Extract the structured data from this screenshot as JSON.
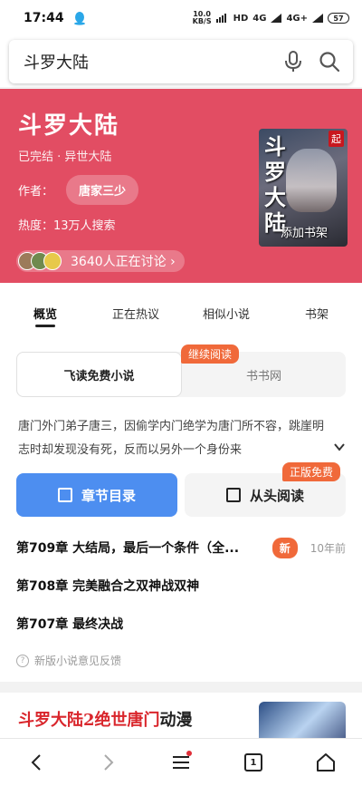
{
  "status_bar": {
    "time": "17:44",
    "speed_value": "10.0",
    "speed_unit": "KB/S",
    "network": "HD",
    "signal1": "4G",
    "signal2": "4G+",
    "battery": "57"
  },
  "search": {
    "query": "斗罗大陆"
  },
  "book": {
    "title": "斗罗大陆",
    "meta": "已完结 · 异世大陆",
    "author_label": "作者：",
    "author": "唐家三少",
    "heat": "热度：13万人搜索",
    "discuss": "3640人正在讨论 ›",
    "cover_badge": "起",
    "cover_title": "斗罗大陆",
    "cover_watermark": "添加书架"
  },
  "tabs": [
    {
      "label": "概览"
    },
    {
      "label": "正在热议"
    },
    {
      "label": "相似小说"
    },
    {
      "label": "书架"
    }
  ],
  "sources": {
    "option1": "飞读免费小说",
    "option2": "书书网",
    "continue_badge": "继续阅读"
  },
  "synopsis": "唐门外门弟子唐三，因偷学内门绝学为唐门所不容，跳崖明志时却发现没有死，反而以另外一个身份来",
  "buttons": {
    "toc": "章节目录",
    "read": "从头阅读",
    "official_badge": "正版免费"
  },
  "chapters": [
    {
      "title": "第709章 大结局，最后一个条件（全...",
      "badge": "新",
      "time": "10年前"
    },
    {
      "title": "第708章 完美融合之双神战双神",
      "badge": "",
      "time": ""
    },
    {
      "title": "第707章 最终决战",
      "badge": "",
      "time": ""
    }
  ],
  "feedback": "新版小说意见反馈",
  "related": {
    "title_red": "斗罗大陆2绝世唐门",
    "title_rest": "动漫"
  },
  "bottom_nav": {
    "tabs_count": "1"
  },
  "colors": {
    "hero_bg": "#e24d63",
    "accent_orange": "#f0693a",
    "primary_blue": "#4d8ef0"
  }
}
